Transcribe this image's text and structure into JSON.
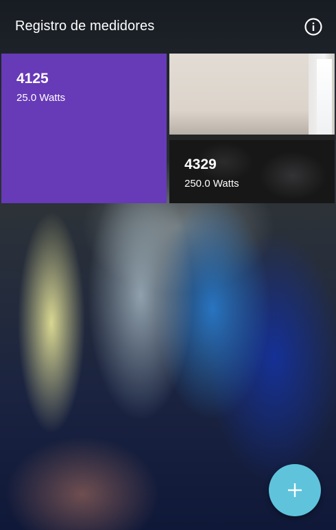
{
  "appbar": {
    "title": "Registro de medidores",
    "info_icon": "info-icon"
  },
  "meters": [
    {
      "id": "4125",
      "power": "25.0 Watts",
      "background": "#673ab7"
    },
    {
      "id": "4329",
      "power": "250.0 Watts",
      "background": "photo"
    }
  ],
  "fab": {
    "icon": "plus-icon",
    "color": "#5fc3dc"
  }
}
